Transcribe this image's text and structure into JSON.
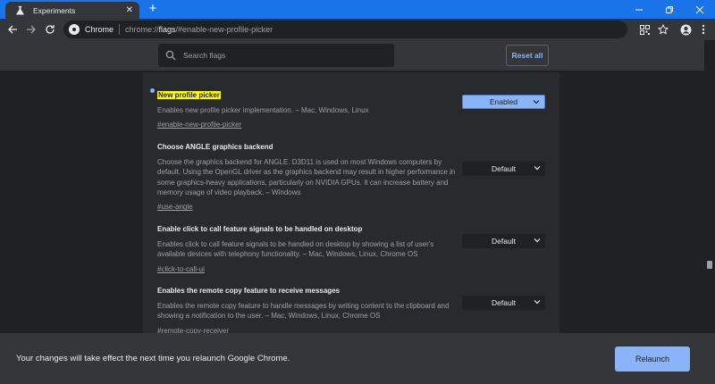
{
  "tab": {
    "title": "Experiments",
    "favicon": "flask-icon"
  },
  "window_controls": [
    "minimize",
    "maximize",
    "close"
  ],
  "omnibox": {
    "site_name": "Chrome",
    "url_prefix": "chrome://",
    "url_host": "flags",
    "url_rest": "/#enable-new-profile-picker"
  },
  "search": {
    "placeholder": "Search flags"
  },
  "reset_label": "Reset all",
  "experiments": [
    {
      "name": "New profile picker",
      "highlighted": true,
      "description": "Enables new profile picker implementation. – Mac, Windows, Linux",
      "link": "#enable-new-profile-picker",
      "value": "Enabled"
    },
    {
      "name": "Choose ANGLE graphics backend",
      "description": "Choose the graphics backend for ANGLE. D3D11 is used on most Windows computers by default. Using the OpenGL driver as the graphics backend may result in higher performance in some graphics-heavy applications, particularly on NVIDIA GPUs. It can increase battery and memory usage of video playback. – Windows",
      "link": "#use-angle",
      "value": "Default"
    },
    {
      "name": "Enable click to call feature signals to be handled on desktop",
      "description": "Enables click to call feature signals to be handled on desktop by showing a list of user's available devices with telephony functionality. – Mac, Windows, Linux, Chrome OS",
      "link": "#click-to-call-ui",
      "value": "Default"
    },
    {
      "name": "Enables the remote copy feature to receive messages",
      "description": "Enables the remote copy feature to handle messages by writing content to the clipboard and showing a notification to the user. – Mac, Windows, Linux, Chrome OS",
      "link": "#remote-copy-receiver",
      "value": "Default"
    }
  ],
  "relaunch": {
    "message": "Your changes will take effect the next time you relaunch Google Chrome.",
    "button_label": "Relaunch"
  },
  "colors": {
    "accent": "#1a73e8",
    "link_blue": "#8ab4f8",
    "highlight": "#ffff00"
  }
}
